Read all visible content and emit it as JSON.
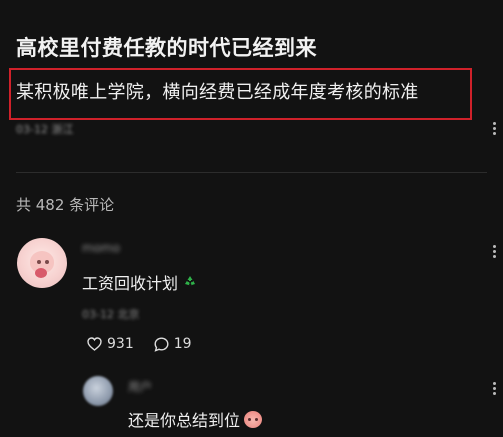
{
  "post": {
    "title": "高校里付费任教的时代已经到来",
    "subtitle": "某积极唯上学院，横向经费已经成年度考核的标准",
    "meta_blurred": "03-12 浙江"
  },
  "comments": {
    "count_label": "共 482 条评论",
    "items": [
      {
        "author_blurred": "momo",
        "text": "工资回收计划",
        "emoji": "recycle-icon",
        "time_blurred": "03-12 北京",
        "likes": "931",
        "replies": "19"
      },
      {
        "author_blurred": "用户",
        "text": "还是你总结到位",
        "emoji": "peach-face-icon"
      }
    ]
  },
  "colors": {
    "background": "#121212",
    "highlight_border": "#d0212a",
    "recycle_green": "#2fb34a"
  }
}
